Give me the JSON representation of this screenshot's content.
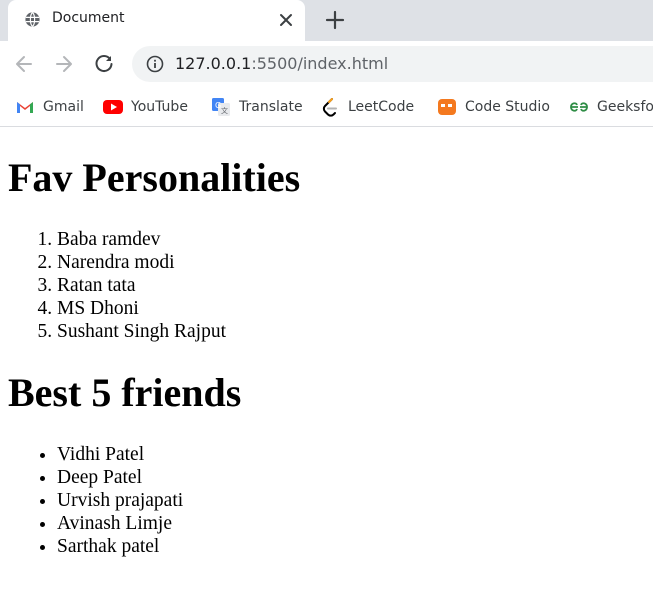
{
  "browser": {
    "tab": {
      "title": "Document"
    },
    "address": {
      "host": "127.0.0.1",
      "rest": ":5500/index.html"
    },
    "bookmarks": [
      {
        "label": "Gmail",
        "icon": "gmail-icon"
      },
      {
        "label": "YouTube",
        "icon": "youtube-icon"
      },
      {
        "label": "Translate",
        "icon": "translate-icon"
      },
      {
        "label": "LeetCode",
        "icon": "leetcode-icon"
      },
      {
        "label": "Code Studio",
        "icon": "codestudio-icon"
      },
      {
        "label": "Geeksfo",
        "icon": "geeksforgeeks-icon"
      }
    ]
  },
  "page": {
    "heading1": "Fav Personalities",
    "personalities": [
      "Baba ramdev",
      "Narendra modi",
      "Ratan tata",
      "MS Dhoni",
      "Sushant Singh Rajput"
    ],
    "heading2": "Best 5 friends",
    "friends": [
      "Vidhi Patel",
      "Deep Patel",
      "Urvish prajapati",
      "Avinash Limje",
      "Sarthak patel"
    ]
  }
}
